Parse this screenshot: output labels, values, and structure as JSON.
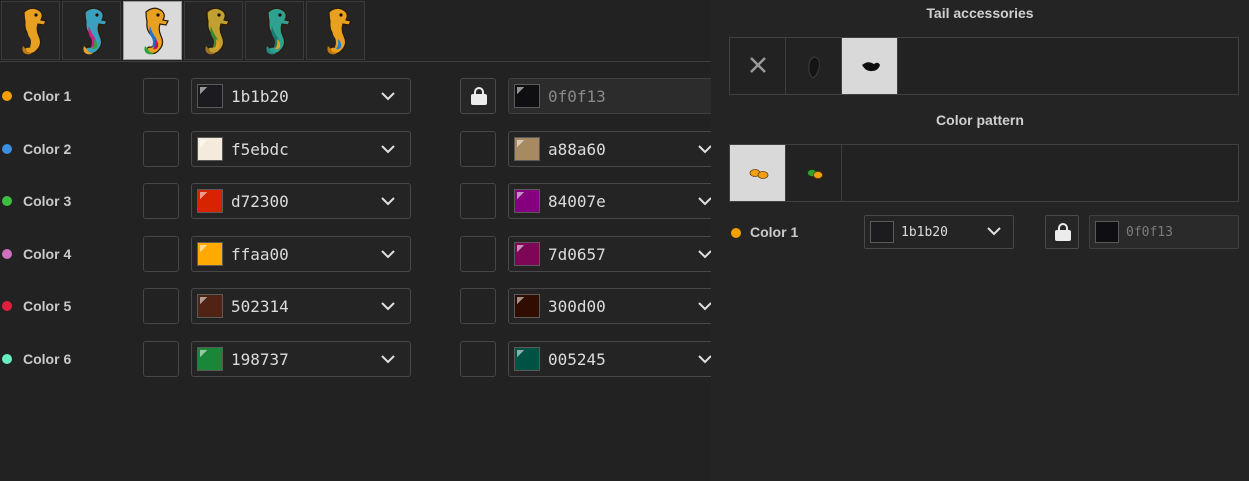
{
  "colors": {
    "orange": "#f5a000",
    "blue": "#3a8fe0",
    "green": "#3ec03e",
    "pink": "#d070c0",
    "red": "#e0203a",
    "mint": "#66f0c0"
  },
  "tabs": [
    {
      "icon": "seahorse-orange-icon"
    },
    {
      "icon": "seahorse-multicolor-icon"
    },
    {
      "icon": "seahorse-rainbow-icon",
      "selected": true
    },
    {
      "icon": "seahorse-green-orange-icon"
    },
    {
      "icon": "seahorse-teal-icon"
    },
    {
      "icon": "seahorse-orange-blue-icon"
    }
  ],
  "rows": [
    {
      "label": "Color 1",
      "dot": "#f5a000",
      "primary": {
        "value": "1b1b20",
        "swatch": "#1b1b20"
      },
      "secondary": {
        "value": "0f0f13",
        "swatch": "#0f0f13",
        "locked": true
      }
    },
    {
      "label": "Color 2",
      "dot": "#3a8fe0",
      "primary": {
        "value": "f5ebdc",
        "swatch": "#f5ebdc"
      },
      "secondary": {
        "value": "a88a60",
        "swatch": "#a88a60"
      }
    },
    {
      "label": "Color 3",
      "dot": "#3ec03e",
      "primary": {
        "value": "d72300",
        "swatch": "#d72300"
      },
      "secondary": {
        "value": "84007e",
        "swatch": "#84007e"
      }
    },
    {
      "label": "Color 4",
      "dot": "#d070c0",
      "primary": {
        "value": "ffaa00",
        "swatch": "#ffaa00"
      },
      "secondary": {
        "value": "7d0657",
        "swatch": "#7d0657"
      }
    },
    {
      "label": "Color 5",
      "dot": "#e0203a",
      "primary": {
        "value": "502314",
        "swatch": "#502314"
      },
      "secondary": {
        "value": "300d00",
        "swatch": "#300d00"
      }
    },
    {
      "label": "Color 6",
      "dot": "#66f0c0",
      "primary": {
        "value": "198737",
        "swatch": "#198737"
      },
      "secondary": {
        "value": "005245",
        "swatch": "#005245"
      }
    }
  ],
  "tail_accessories": {
    "title": "Tail accessories",
    "options": [
      {
        "icon": "none-x-icon"
      },
      {
        "icon": "tail-fin-dark-icon"
      },
      {
        "icon": "tail-fin-black-icon",
        "selected": true
      }
    ]
  },
  "color_pattern": {
    "title": "Color pattern",
    "options": [
      {
        "icon": "pattern-orange-icon",
        "selected": true
      },
      {
        "icon": "pattern-green-orange-icon"
      }
    ]
  },
  "pattern_color": {
    "label": "Color 1",
    "dot": "#f5a000",
    "primary": {
      "value": "1b1b20",
      "swatch": "#1b1b20"
    },
    "secondary": {
      "value": "0f0f13",
      "swatch": "#0f0f13",
      "locked": true
    }
  }
}
